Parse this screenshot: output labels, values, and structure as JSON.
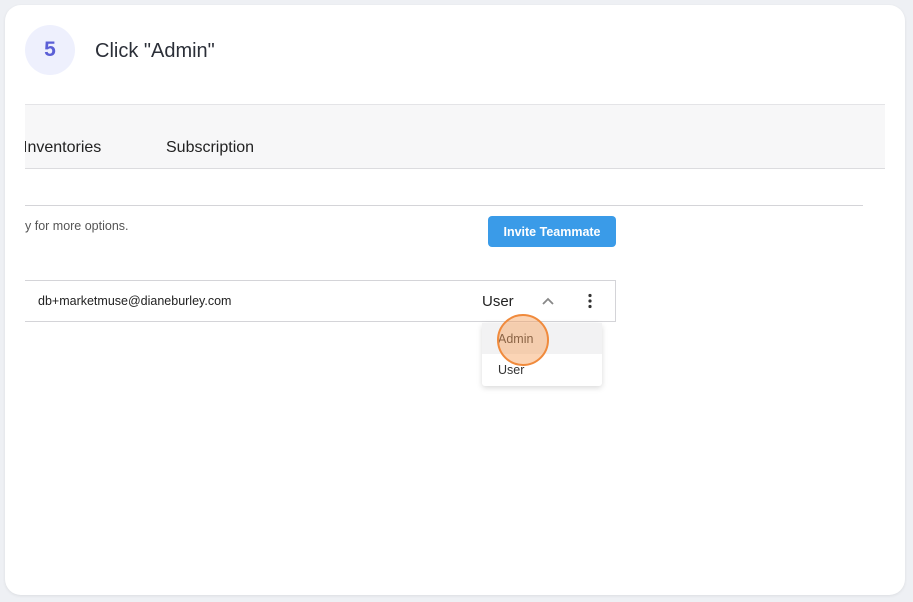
{
  "step": {
    "number": "5",
    "instruction": "Click \"Admin\""
  },
  "tabs": {
    "inventories": "Inventories",
    "subscription": "Subscription"
  },
  "team": {
    "hint_text": "y for more options.",
    "invite_button": "Invite Teammate",
    "member": {
      "email": "db+marketmuse@dianeburley.com",
      "role": "User"
    }
  },
  "role_menu": {
    "options": [
      "Admin",
      "User"
    ],
    "highlighted": "Admin"
  },
  "colors": {
    "accent_button": "#3a9be8",
    "step_badge": "#5b5fd6",
    "highlight_ring": "#f08a3c"
  },
  "icons": {
    "role_toggle": "chevron-up-icon",
    "row_actions": "more-vertical-icon"
  }
}
